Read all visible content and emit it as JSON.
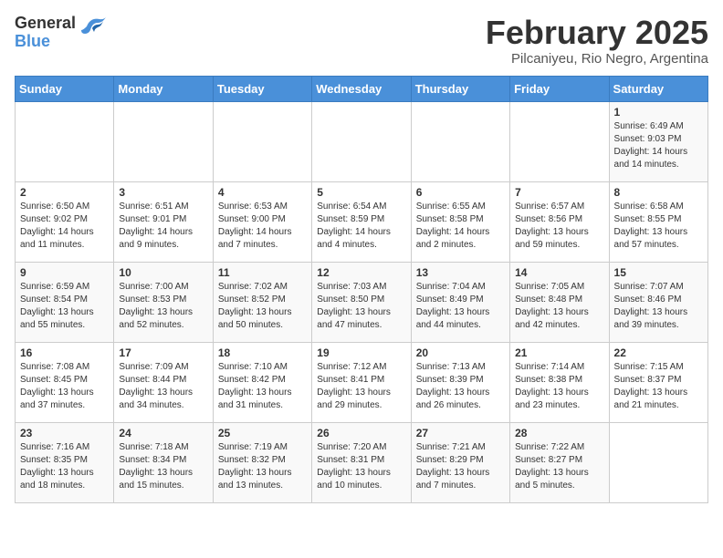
{
  "logo": {
    "general": "General",
    "blue": "Blue"
  },
  "title": "February 2025",
  "subtitle": "Pilcaniyeu, Rio Negro, Argentina",
  "header": {
    "days": [
      "Sunday",
      "Monday",
      "Tuesday",
      "Wednesday",
      "Thursday",
      "Friday",
      "Saturday"
    ]
  },
  "weeks": [
    [
      {
        "day": "",
        "info": ""
      },
      {
        "day": "",
        "info": ""
      },
      {
        "day": "",
        "info": ""
      },
      {
        "day": "",
        "info": ""
      },
      {
        "day": "",
        "info": ""
      },
      {
        "day": "",
        "info": ""
      },
      {
        "day": "1",
        "info": "Sunrise: 6:49 AM\nSunset: 9:03 PM\nDaylight: 14 hours\nand 14 minutes."
      }
    ],
    [
      {
        "day": "2",
        "info": "Sunrise: 6:50 AM\nSunset: 9:02 PM\nDaylight: 14 hours\nand 11 minutes."
      },
      {
        "day": "3",
        "info": "Sunrise: 6:51 AM\nSunset: 9:01 PM\nDaylight: 14 hours\nand 9 minutes."
      },
      {
        "day": "4",
        "info": "Sunrise: 6:53 AM\nSunset: 9:00 PM\nDaylight: 14 hours\nand 7 minutes."
      },
      {
        "day": "5",
        "info": "Sunrise: 6:54 AM\nSunset: 8:59 PM\nDaylight: 14 hours\nand 4 minutes."
      },
      {
        "day": "6",
        "info": "Sunrise: 6:55 AM\nSunset: 8:58 PM\nDaylight: 14 hours\nand 2 minutes."
      },
      {
        "day": "7",
        "info": "Sunrise: 6:57 AM\nSunset: 8:56 PM\nDaylight: 13 hours\nand 59 minutes."
      },
      {
        "day": "8",
        "info": "Sunrise: 6:58 AM\nSunset: 8:55 PM\nDaylight: 13 hours\nand 57 minutes."
      }
    ],
    [
      {
        "day": "9",
        "info": "Sunrise: 6:59 AM\nSunset: 8:54 PM\nDaylight: 13 hours\nand 55 minutes."
      },
      {
        "day": "10",
        "info": "Sunrise: 7:00 AM\nSunset: 8:53 PM\nDaylight: 13 hours\nand 52 minutes."
      },
      {
        "day": "11",
        "info": "Sunrise: 7:02 AM\nSunset: 8:52 PM\nDaylight: 13 hours\nand 50 minutes."
      },
      {
        "day": "12",
        "info": "Sunrise: 7:03 AM\nSunset: 8:50 PM\nDaylight: 13 hours\nand 47 minutes."
      },
      {
        "day": "13",
        "info": "Sunrise: 7:04 AM\nSunset: 8:49 PM\nDaylight: 13 hours\nand 44 minutes."
      },
      {
        "day": "14",
        "info": "Sunrise: 7:05 AM\nSunset: 8:48 PM\nDaylight: 13 hours\nand 42 minutes."
      },
      {
        "day": "15",
        "info": "Sunrise: 7:07 AM\nSunset: 8:46 PM\nDaylight: 13 hours\nand 39 minutes."
      }
    ],
    [
      {
        "day": "16",
        "info": "Sunrise: 7:08 AM\nSunset: 8:45 PM\nDaylight: 13 hours\nand 37 minutes."
      },
      {
        "day": "17",
        "info": "Sunrise: 7:09 AM\nSunset: 8:44 PM\nDaylight: 13 hours\nand 34 minutes."
      },
      {
        "day": "18",
        "info": "Sunrise: 7:10 AM\nSunset: 8:42 PM\nDaylight: 13 hours\nand 31 minutes."
      },
      {
        "day": "19",
        "info": "Sunrise: 7:12 AM\nSunset: 8:41 PM\nDaylight: 13 hours\nand 29 minutes."
      },
      {
        "day": "20",
        "info": "Sunrise: 7:13 AM\nSunset: 8:39 PM\nDaylight: 13 hours\nand 26 minutes."
      },
      {
        "day": "21",
        "info": "Sunrise: 7:14 AM\nSunset: 8:38 PM\nDaylight: 13 hours\nand 23 minutes."
      },
      {
        "day": "22",
        "info": "Sunrise: 7:15 AM\nSunset: 8:37 PM\nDaylight: 13 hours\nand 21 minutes."
      }
    ],
    [
      {
        "day": "23",
        "info": "Sunrise: 7:16 AM\nSunset: 8:35 PM\nDaylight: 13 hours\nand 18 minutes."
      },
      {
        "day": "24",
        "info": "Sunrise: 7:18 AM\nSunset: 8:34 PM\nDaylight: 13 hours\nand 15 minutes."
      },
      {
        "day": "25",
        "info": "Sunrise: 7:19 AM\nSunset: 8:32 PM\nDaylight: 13 hours\nand 13 minutes."
      },
      {
        "day": "26",
        "info": "Sunrise: 7:20 AM\nSunset: 8:31 PM\nDaylight: 13 hours\nand 10 minutes."
      },
      {
        "day": "27",
        "info": "Sunrise: 7:21 AM\nSunset: 8:29 PM\nDaylight: 13 hours\nand 7 minutes."
      },
      {
        "day": "28",
        "info": "Sunrise: 7:22 AM\nSunset: 8:27 PM\nDaylight: 13 hours\nand 5 minutes."
      },
      {
        "day": "",
        "info": ""
      }
    ]
  ]
}
